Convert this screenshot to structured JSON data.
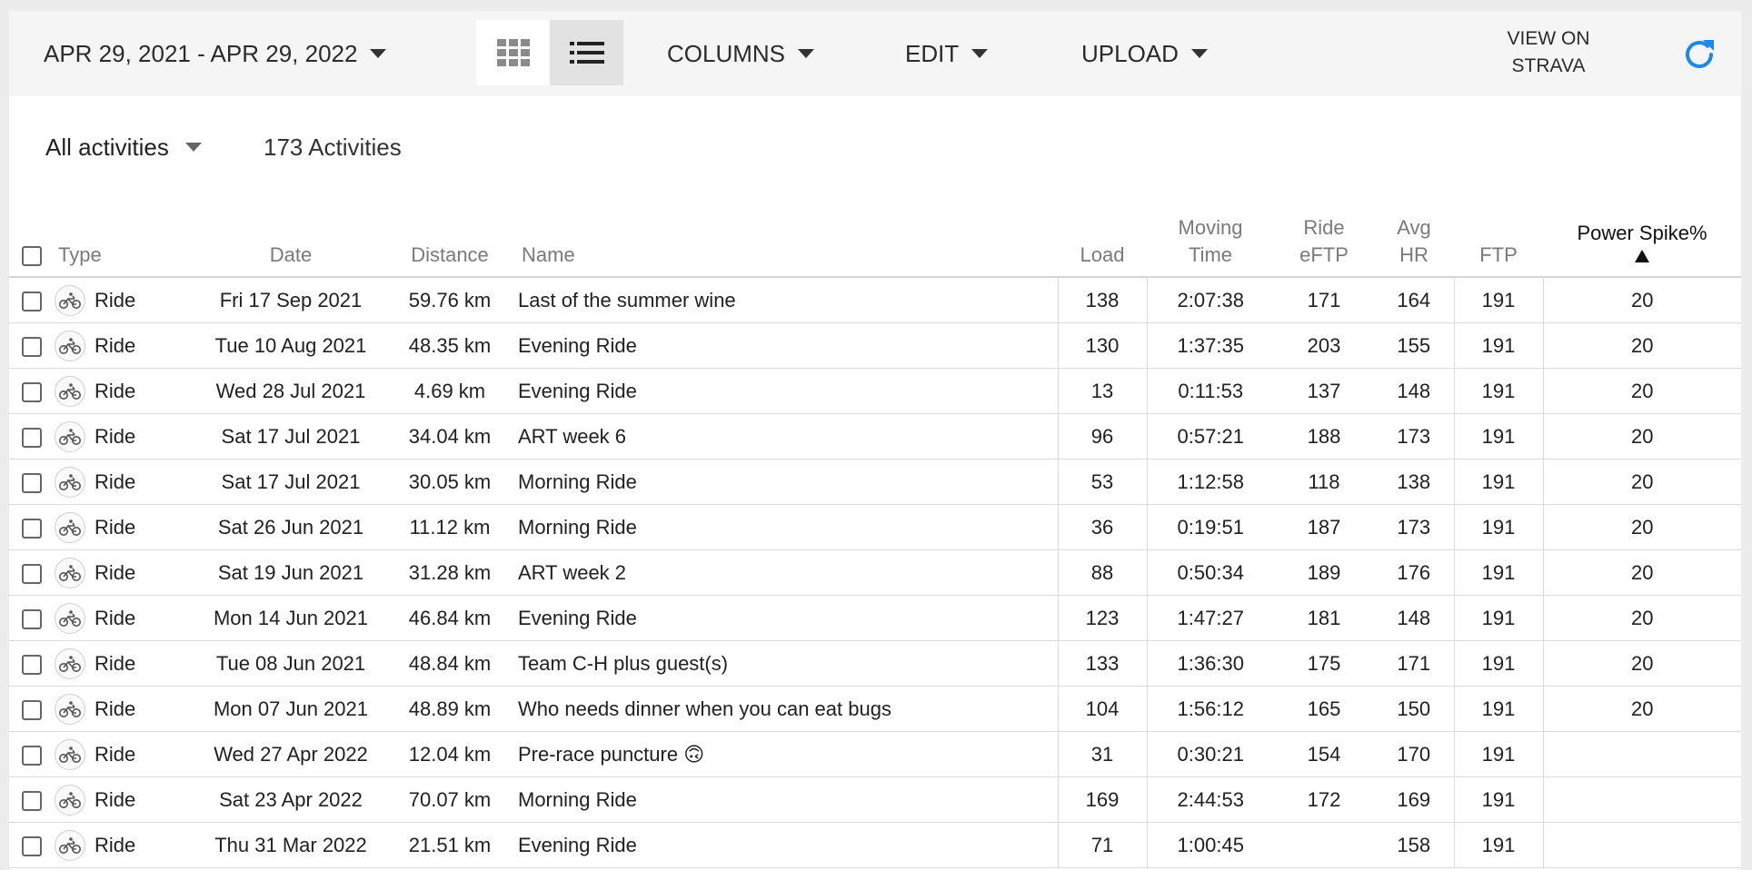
{
  "toolbar": {
    "date_range": "APR 29, 2021 - APR 29, 2022",
    "columns": "COLUMNS",
    "edit": "EDIT",
    "upload": "UPLOAD",
    "view_on_line1": "VIEW ON",
    "view_on_line2": "STRAVA"
  },
  "filter": {
    "label": "All activities",
    "count": "173 Activities"
  },
  "columns": {
    "type": "Type",
    "date": "Date",
    "distance": "Distance",
    "name": "Name",
    "load": "Load",
    "moving_time_1": "Moving",
    "moving_time_2": "Time",
    "ride_eftp_1": "Ride",
    "ride_eftp_2": "eFTP",
    "avg_hr_1": "Avg",
    "avg_hr_2": "HR",
    "ftp": "FTP",
    "power_spike": "Power Spike%"
  },
  "rows": [
    {
      "type": "Ride",
      "date": "Fri 17 Sep 2021",
      "distance": "59.76 km",
      "name": "Last of the summer wine",
      "load": "138",
      "moving_time": "2:07:38",
      "ride_eftp": "171",
      "avg_hr": "164",
      "ftp": "191",
      "power_spike": "20"
    },
    {
      "type": "Ride",
      "date": "Tue 10 Aug 2021",
      "distance": "48.35 km",
      "name": "Evening Ride",
      "load": "130",
      "moving_time": "1:37:35",
      "ride_eftp": "203",
      "avg_hr": "155",
      "ftp": "191",
      "power_spike": "20"
    },
    {
      "type": "Ride",
      "date": "Wed 28 Jul 2021",
      "distance": "4.69 km",
      "name": "Evening Ride",
      "load": "13",
      "moving_time": "0:11:53",
      "ride_eftp": "137",
      "avg_hr": "148",
      "ftp": "191",
      "power_spike": "20"
    },
    {
      "type": "Ride",
      "date": "Sat 17 Jul 2021",
      "distance": "34.04 km",
      "name": "ART week 6",
      "load": "96",
      "moving_time": "0:57:21",
      "ride_eftp": "188",
      "avg_hr": "173",
      "ftp": "191",
      "power_spike": "20"
    },
    {
      "type": "Ride",
      "date": "Sat 17 Jul 2021",
      "distance": "30.05 km",
      "name": "Morning Ride",
      "load": "53",
      "moving_time": "1:12:58",
      "ride_eftp": "118",
      "avg_hr": "138",
      "ftp": "191",
      "power_spike": "20"
    },
    {
      "type": "Ride",
      "date": "Sat 26 Jun 2021",
      "distance": "11.12 km",
      "name": "Morning Ride",
      "load": "36",
      "moving_time": "0:19:51",
      "ride_eftp": "187",
      "avg_hr": "173",
      "ftp": "191",
      "power_spike": "20"
    },
    {
      "type": "Ride",
      "date": "Sat 19 Jun 2021",
      "distance": "31.28 km",
      "name": "ART week 2",
      "load": "88",
      "moving_time": "0:50:34",
      "ride_eftp": "189",
      "avg_hr": "176",
      "ftp": "191",
      "power_spike": "20"
    },
    {
      "type": "Ride",
      "date": "Mon 14 Jun 2021",
      "distance": "46.84 km",
      "name": "Evening Ride",
      "load": "123",
      "moving_time": "1:47:27",
      "ride_eftp": "181",
      "avg_hr": "148",
      "ftp": "191",
      "power_spike": "20"
    },
    {
      "type": "Ride",
      "date": "Tue 08 Jun 2021",
      "distance": "48.84 km",
      "name": "Team C-H plus guest(s)",
      "load": "133",
      "moving_time": "1:36:30",
      "ride_eftp": "175",
      "avg_hr": "171",
      "ftp": "191",
      "power_spike": "20"
    },
    {
      "type": "Ride",
      "date": "Mon 07 Jun 2021",
      "distance": "48.89 km",
      "name": "Who needs dinner when you can eat bugs",
      "load": "104",
      "moving_time": "1:56:12",
      "ride_eftp": "165",
      "avg_hr": "150",
      "ftp": "191",
      "power_spike": "20"
    },
    {
      "type": "Ride",
      "date": "Wed 27 Apr 2022",
      "distance": "12.04 km",
      "name": "Pre-race puncture 🙃",
      "load": "31",
      "moving_time": "0:30:21",
      "ride_eftp": "154",
      "avg_hr": "170",
      "ftp": "191",
      "power_spike": ""
    },
    {
      "type": "Ride",
      "date": "Sat 23 Apr 2022",
      "distance": "70.07 km",
      "name": "Morning Ride",
      "load": "169",
      "moving_time": "2:44:53",
      "ride_eftp": "172",
      "avg_hr": "169",
      "ftp": "191",
      "power_spike": ""
    },
    {
      "type": "Ride",
      "date": "Thu 31 Mar 2022",
      "distance": "21.51 km",
      "name": "Evening Ride",
      "load": "71",
      "moving_time": "1:00:45",
      "ride_eftp": "",
      "avg_hr": "158",
      "ftp": "191",
      "power_spike": ""
    }
  ],
  "icons": {
    "grid_view": "grid-icon",
    "list_view": "list-icon",
    "refresh": "refresh-icon",
    "activity_type": "bike-icon"
  },
  "colors": {
    "accent": "#1e88e5",
    "toolbar_bg": "#f5f5f5"
  }
}
